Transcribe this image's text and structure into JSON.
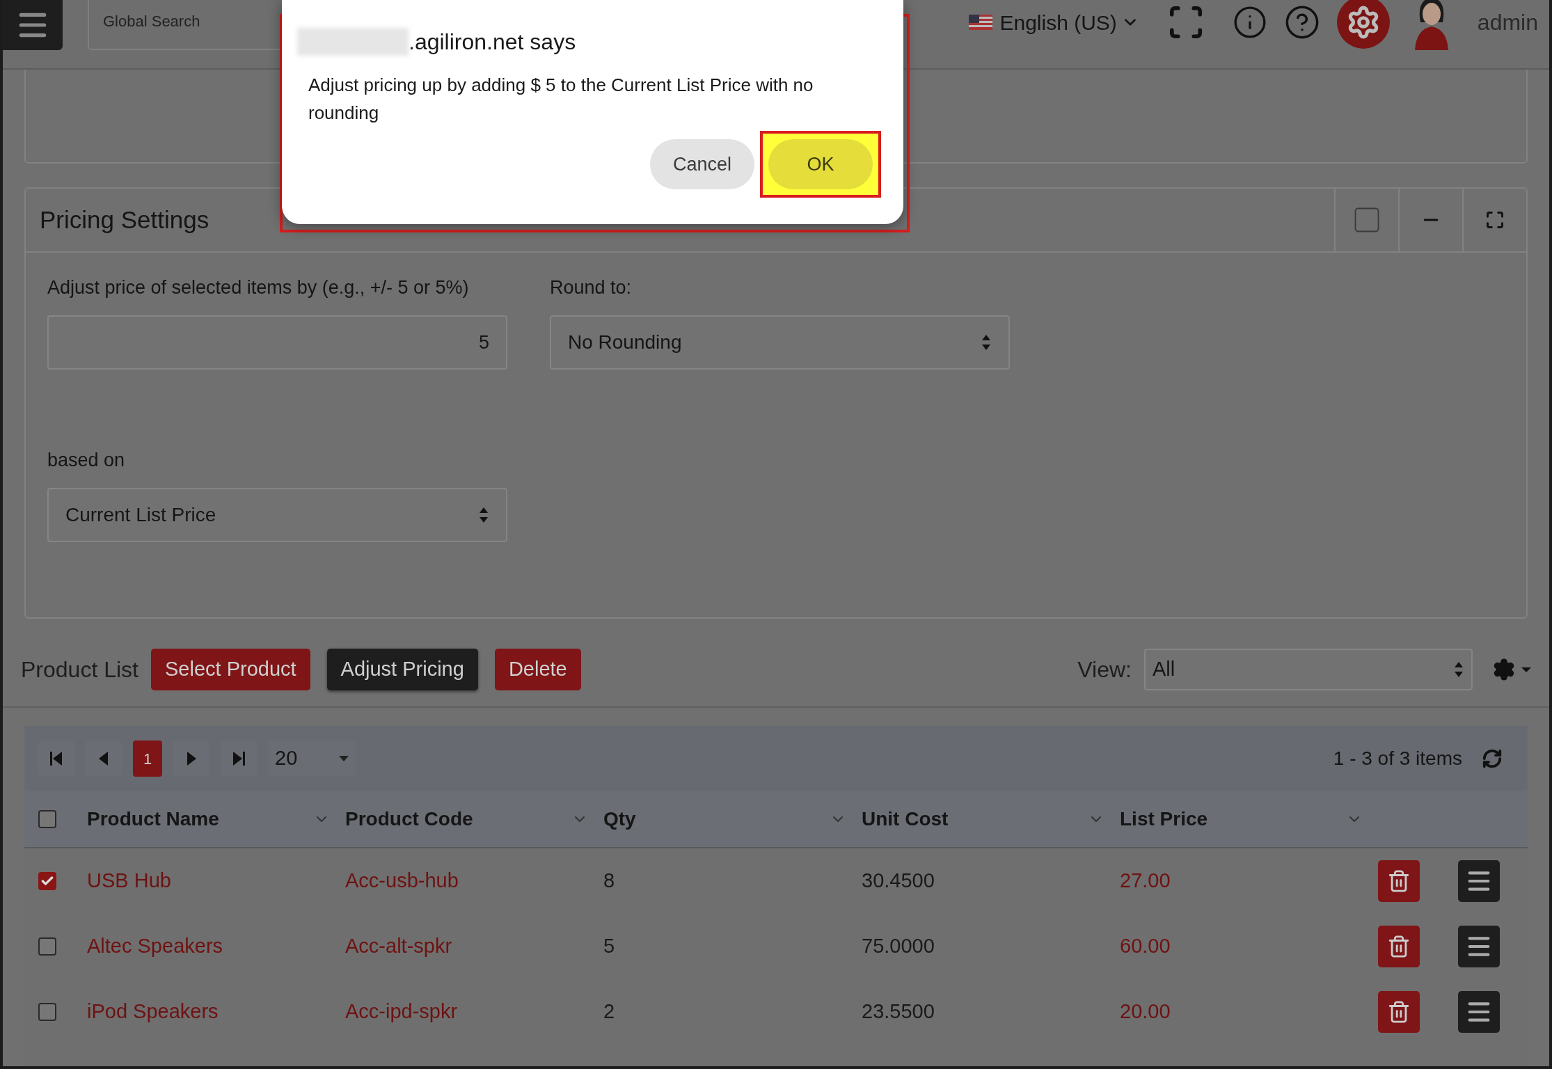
{
  "header": {
    "search_placeholder": "Global Search",
    "language": "English (US)",
    "user": "admin"
  },
  "dialog": {
    "highlighted": true,
    "origin": ".agiliron.net says",
    "message": "Adjust pricing up by adding $ 5 to the Current List Price with no rounding",
    "buttons": [
      {
        "label": "Cancel",
        "highlighted": false
      },
      {
        "label": "OK",
        "highlighted": true
      }
    ]
  },
  "pricing_settings": {
    "title": "Pricing Settings",
    "fields": [
      {
        "label": "Adjust price of selected items by (e.g., +/- 5 or 5%)",
        "kind": "text",
        "value": "5"
      },
      {
        "label": "Round to:",
        "kind": "select",
        "value": "No Rounding"
      },
      {
        "label": "based on",
        "kind": "select",
        "value": "Current List Price"
      }
    ]
  },
  "product_list": {
    "title": "Product List",
    "buttons": [
      {
        "label": "Select Product",
        "kind": "danger"
      },
      {
        "label": "Adjust Pricing",
        "kind": "dark"
      },
      {
        "label": "Delete",
        "kind": "danger"
      }
    ],
    "view_label": "View:",
    "view_value": "All"
  },
  "grid": {
    "current_page": "1",
    "page_size": "20",
    "summary": "1 - 3 of 3 items",
    "all_checked": false,
    "columns": [
      "Product Name",
      "Product Code",
      "Qty",
      "Unit Cost",
      "List Price"
    ],
    "rows": [
      {
        "checked": true,
        "cells": [
          "USB Hub",
          "Acc-usb-hub",
          "8",
          "30.4500",
          "27.00"
        ]
      },
      {
        "checked": false,
        "cells": [
          "Altec Speakers",
          "Acc-alt-spkr",
          "5",
          "75.0000",
          "60.00"
        ]
      },
      {
        "checked": false,
        "cells": [
          "iPod Speakers",
          "Acc-ipd-spkr",
          "2",
          "23.5500",
          "20.00"
        ]
      }
    ]
  }
}
